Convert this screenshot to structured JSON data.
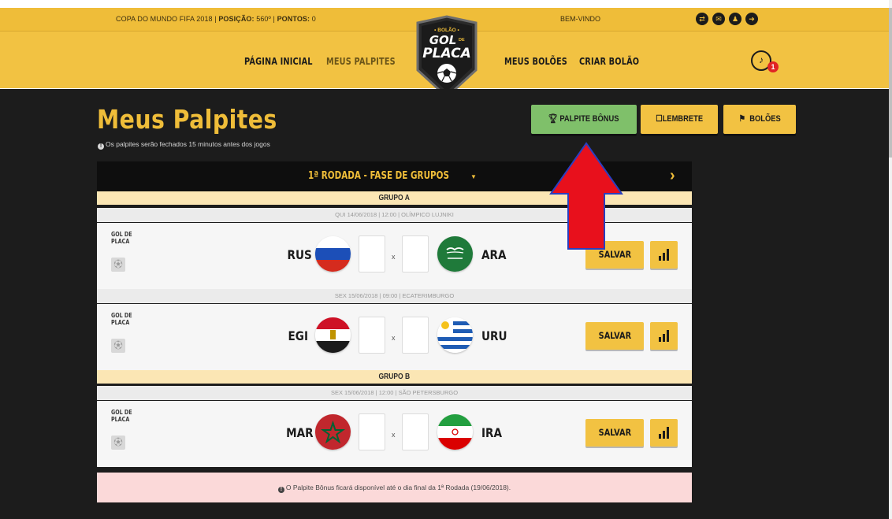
{
  "header": {
    "stats_prefix": "COPA DO MUNDO FIFA 2018 | ",
    "position_label": "POSIÇÃO:",
    "position_value": " 560º | ",
    "points_label": "PONTOS:",
    "points_value": " 0",
    "welcome": "BEM-VINDO",
    "icons": [
      "swap-icon",
      "mail-icon",
      "user-icon",
      "logout-icon"
    ]
  },
  "nav": {
    "home": "PÁGINA INICIAL",
    "my_predictions": "MEUS PALPITES",
    "my_pools": "MEUS BOLÕES",
    "create_pool": "CRIAR BOLÃO",
    "notification_count": "1"
  },
  "logo": {
    "top": "• BOLÃO •",
    "line1": "GOL",
    "line1_small": "DE",
    "line2": "PLACA"
  },
  "page": {
    "title": "Meus Palpites",
    "subtitle": "Os palpites serão fechados 15 minutos antes dos jogos",
    "btn_bonus": "PALPITE BÔNUS",
    "btn_reminder": "LEMBRETE",
    "btn_pools": "BOLÕES"
  },
  "round": {
    "title": "1ª RODADA - FASE DE GRUPOS"
  },
  "groups": [
    {
      "name": "GRUPO A"
    },
    {
      "name": "GRUPO B"
    }
  ],
  "matches": [
    {
      "date": "QUI 14/06/2018 | 12:00 | OLÍMPICO LUJNIKI",
      "home": "RUS",
      "away": "ARA",
      "home_score": "",
      "away_score": "",
      "gol_label_1": "GOL DE",
      "gol_label_2": "PLACA",
      "vs": "x",
      "save": "SALVAR"
    },
    {
      "date": "SEX 15/06/2018 | 09:00 | ECATERIMBURGO",
      "home": "EGI",
      "away": "URU",
      "home_score": "",
      "away_score": "",
      "gol_label_1": "GOL DE",
      "gol_label_2": "PLACA",
      "vs": "x",
      "save": "SALVAR"
    },
    {
      "date": "SEX 15/06/2018 | 12:00 | SÃO PETERSBURGO",
      "home": "MAR",
      "away": "IRA",
      "home_score": "",
      "away_score": "",
      "gol_label_1": "GOL DE",
      "gol_label_2": "PLACA",
      "vs": "x",
      "save": "SALVAR"
    }
  ],
  "notice": "O Palpite Bônus ficará disponível até o dia final da 1ª Rodada (19/06/2018).",
  "colors": {
    "brand_yellow": "#f2c242",
    "dark_bg": "#1c1c1c",
    "bonus_green": "#7fc06a",
    "annotation_red": "#e8101c"
  }
}
